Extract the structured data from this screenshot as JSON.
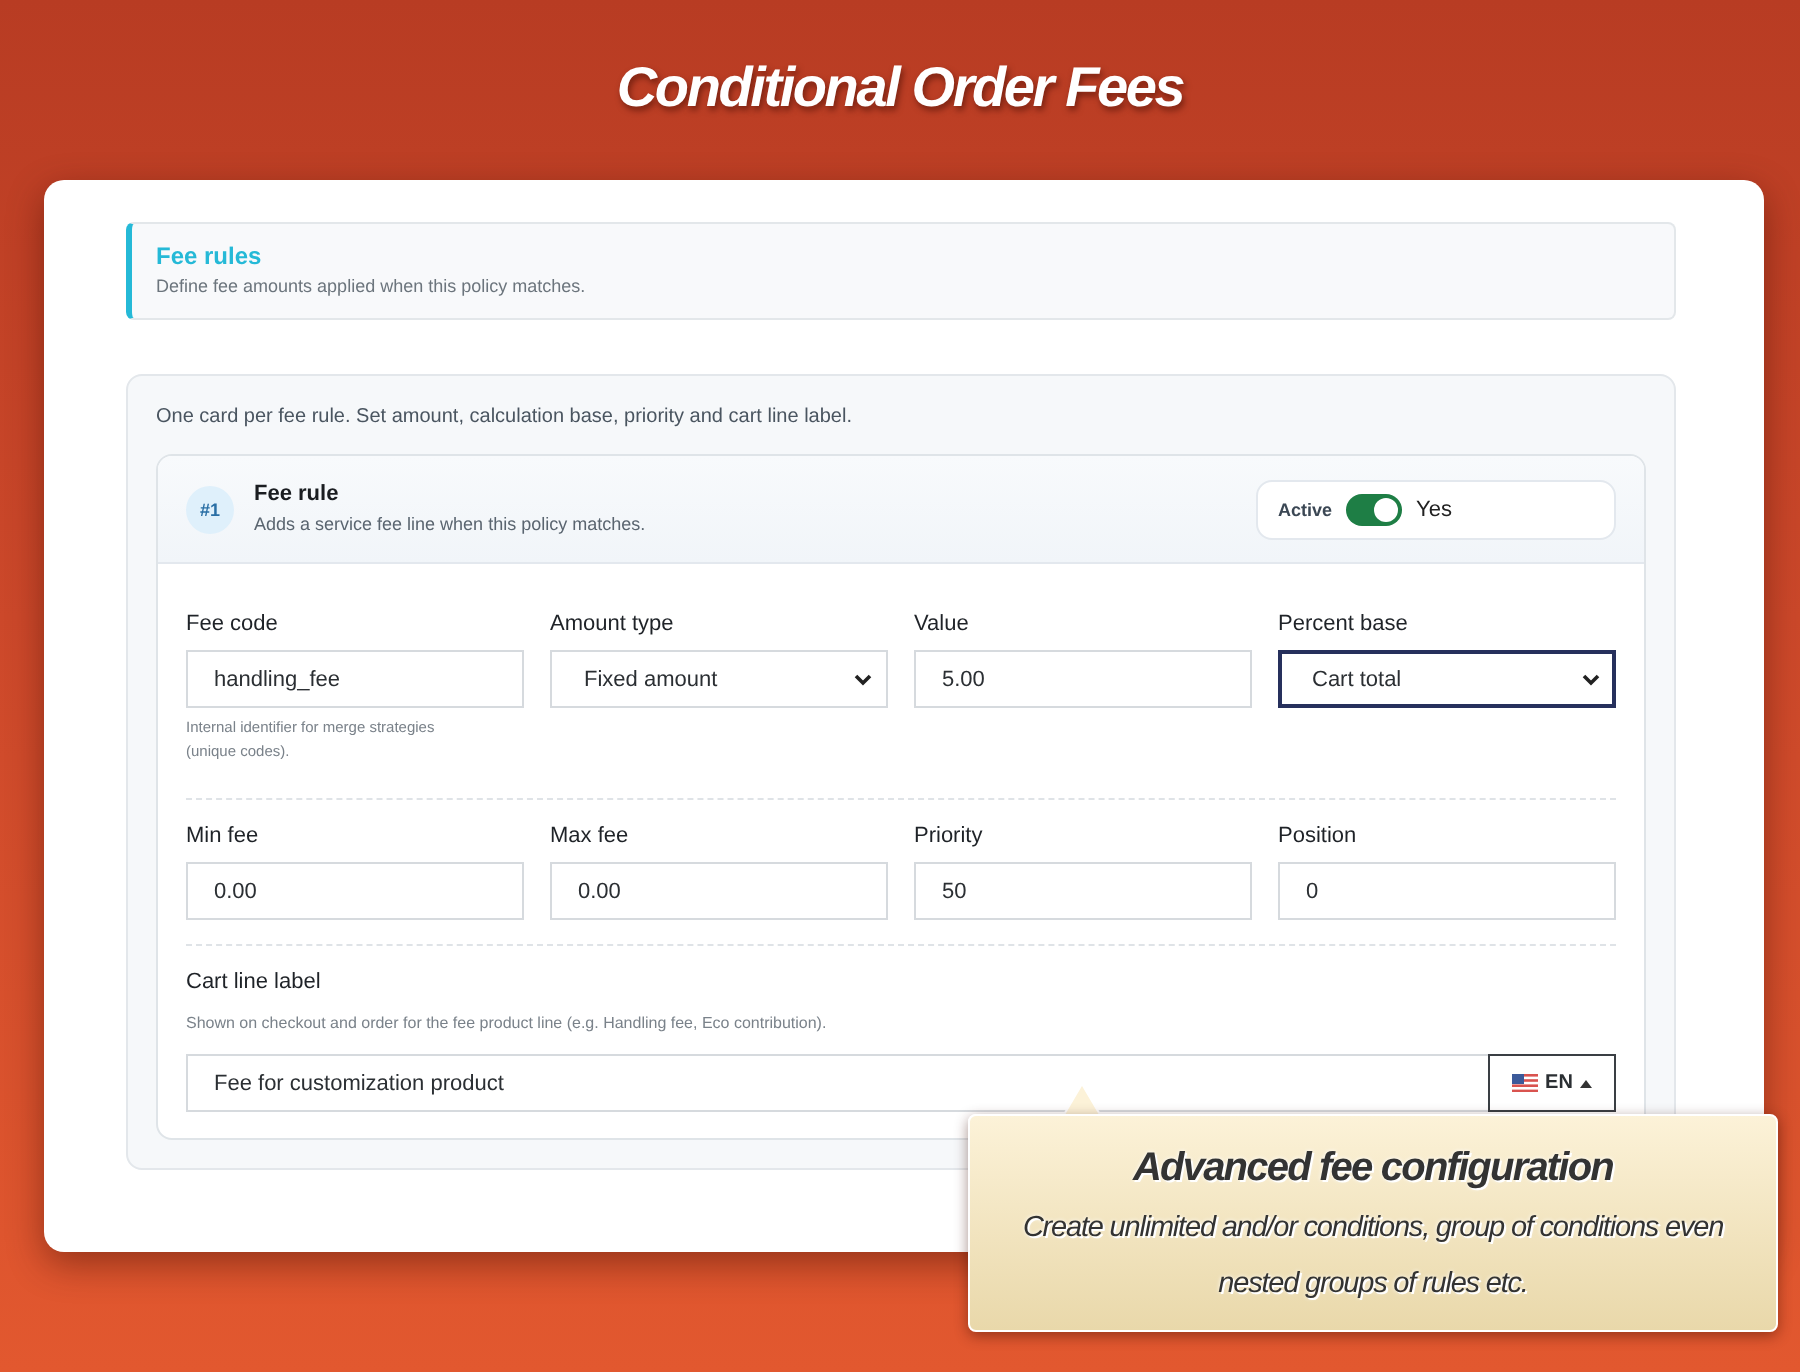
{
  "page": {
    "title": "Conditional Order Fees"
  },
  "fee_rules_header": {
    "title": "Fee rules",
    "description": "Define fee amounts applied when this policy matches."
  },
  "rules_card": {
    "intro": "One card per fee rule. Set amount, calculation base, priority and cart line label.",
    "rules": [
      {
        "badge": "#1",
        "title": "Fee rule",
        "subtitle": "Adds a service fee line when this policy matches.",
        "active": {
          "label": "Active",
          "on": true,
          "state_text": "Yes"
        },
        "field_rows": [
          [
            {
              "kind": "text",
              "label": "Fee code",
              "value": "handling_fee",
              "help": "Internal identifier for merge strategies (unique codes).",
              "focused": false
            },
            {
              "kind": "select",
              "label": "Amount type",
              "value": "Fixed amount",
              "focused": false
            },
            {
              "kind": "text",
              "label": "Value",
              "value": "5.00",
              "focused": false
            },
            {
              "kind": "select",
              "label": "Percent base",
              "value": "Cart total",
              "focused": true
            }
          ],
          [
            {
              "kind": "text",
              "label": "Min fee",
              "value": "0.00",
              "focused": false
            },
            {
              "kind": "text",
              "label": "Max fee",
              "value": "0.00",
              "focused": false
            },
            {
              "kind": "text",
              "label": "Priority",
              "value": "50",
              "focused": false
            },
            {
              "kind": "text",
              "label": "Position",
              "value": "0",
              "focused": false
            }
          ]
        ],
        "cart_line_label": {
          "label": "Cart line label",
          "help": "Shown on checkout and order for the fee product line (e.g. Handling fee, Eco contribution).",
          "value": "Fee for customization product",
          "language": "EN"
        }
      }
    ]
  },
  "callout": {
    "title": "Advanced fee configuration",
    "text": "Create unlimited and/or conditions, group of conditions even nested groups of rules etc."
  }
}
